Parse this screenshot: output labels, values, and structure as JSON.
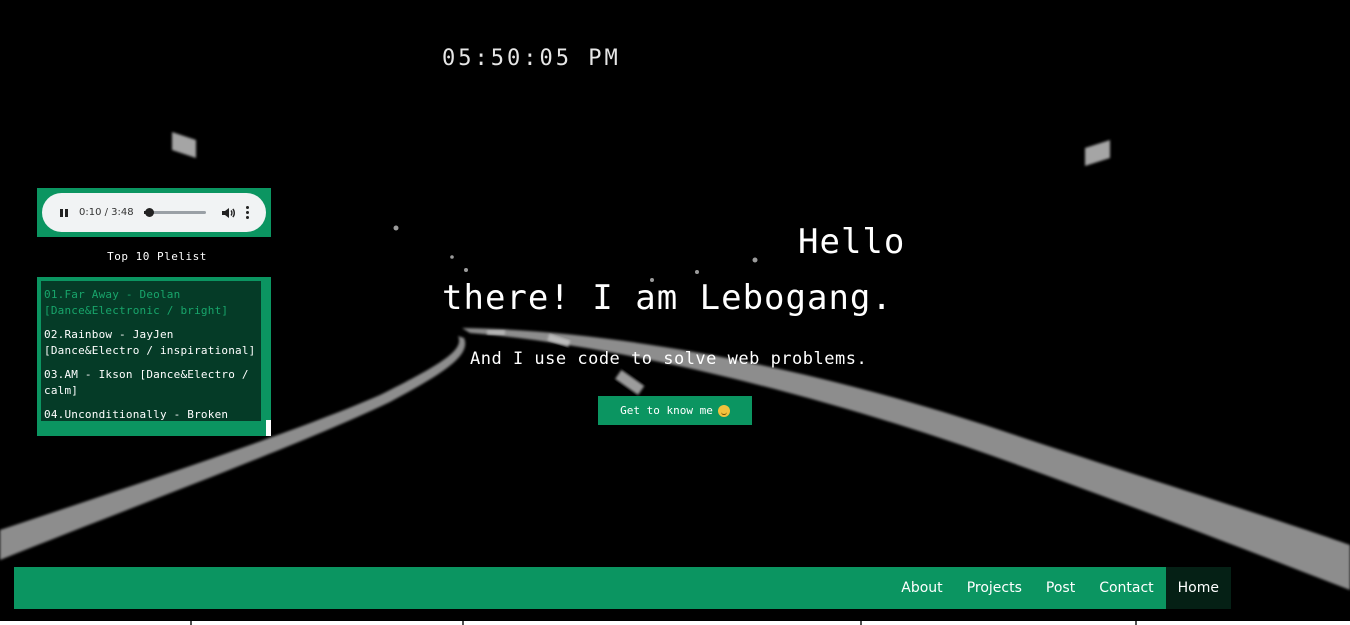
{
  "clock": "05:50:05 PM",
  "player": {
    "time": "0:10 / 3:48",
    "progress": 0.044
  },
  "playlist": {
    "title": "Top 10 Plelist",
    "tracks": [
      "01.Far Away - Deolan [Dance&Electronic / bright]",
      "02.Rainbow - JayJen [Dance&Electro / inspirational]",
      "03.AM - Ikson [Dance&Electro / calm]",
      "04.Unconditionally - Broken"
    ]
  },
  "hero": {
    "hello": "Hello",
    "intro": "there! I am Lebogang.",
    "tagline": "And I use code to solve web problems.",
    "cta_label": "Get to know me"
  },
  "nav": {
    "items": [
      "About",
      "Projects",
      "Post",
      "Contact",
      "Home"
    ]
  },
  "colors": {
    "accent": "#0b9561",
    "dark_accent": "#053b27",
    "background": "#000000"
  }
}
